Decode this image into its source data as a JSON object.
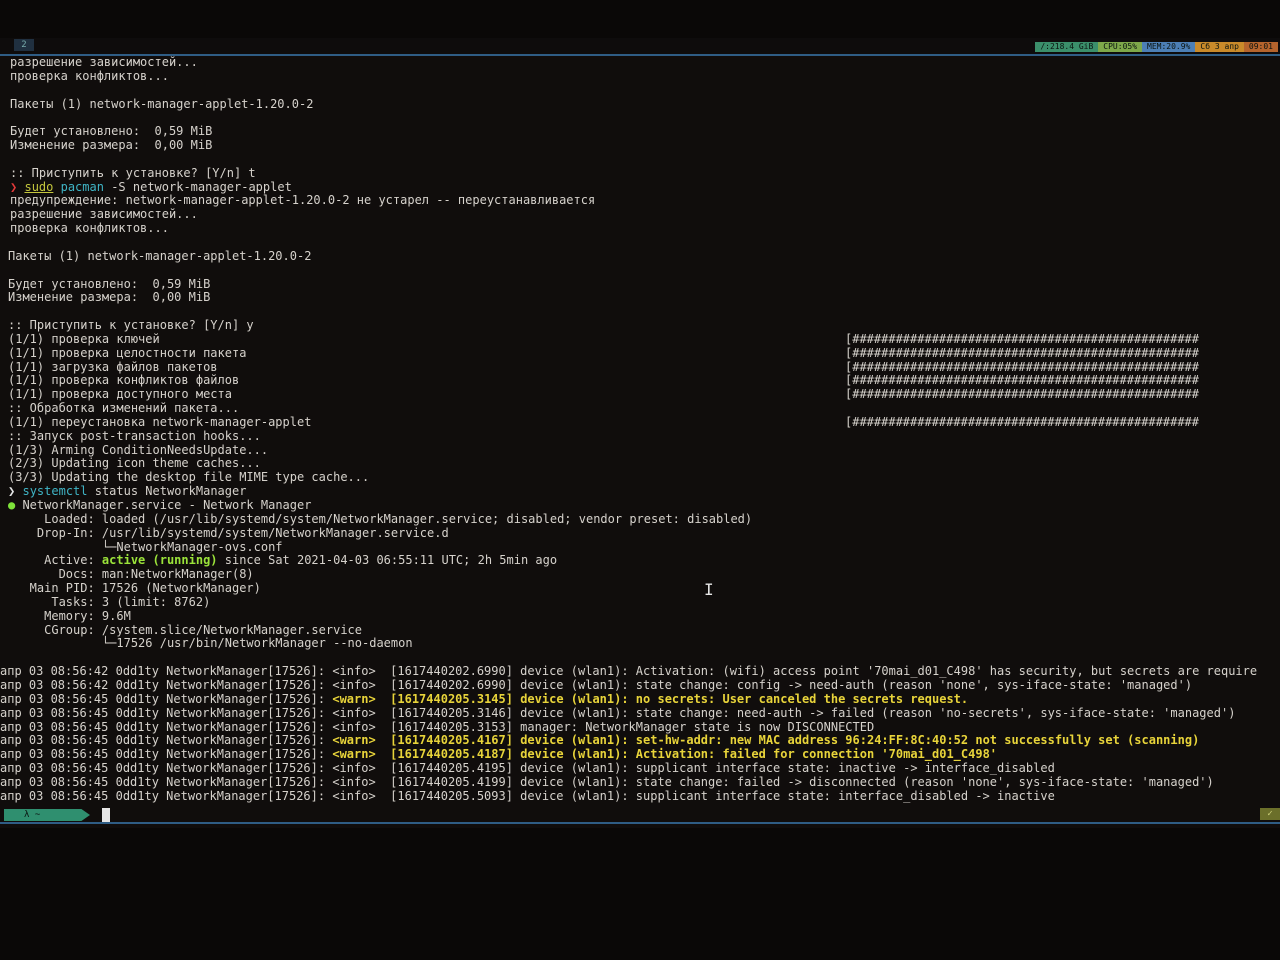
{
  "statusbar": {
    "workspace": "2",
    "disk": "/:218.4 GiB",
    "cpu": "CPU:05%",
    "mem": "MEM:20.9%",
    "date": "Сб 3 апр",
    "time": "09:01"
  },
  "terminal": {
    "lines": [
      {
        "text": "разрешение зависимостей...",
        "indent": "ind1"
      },
      {
        "text": "проверка конфликтов...",
        "indent": "ind1"
      },
      {
        "text": "",
        "indent": "ind1"
      },
      {
        "text": "Пакеты (1) network-manager-applet-1.20.0-2",
        "indent": "ind1"
      },
      {
        "text": "",
        "indent": "ind1"
      },
      {
        "text": "Будет установлено:  0,59 MiB",
        "indent": "ind1"
      },
      {
        "text": "Изменение размера:  0,00 MiB",
        "indent": "ind1"
      },
      {
        "text": "",
        "indent": "ind1"
      },
      {
        "text": ":: Приступить к установке? [Y/n] t",
        "indent": "ind1"
      },
      {
        "type": "cmd",
        "glyph": "❯",
        "glyph_class": "prompt-glyph",
        "sudo": "sudo",
        "cmd": "pacman",
        "rest": " -S network-manager-applet"
      },
      {
        "text": "предупреждение: network-manager-applet-1.20.0-2 не устарел -- переустанавливается",
        "indent": "ind1"
      },
      {
        "text": "разрешение зависимостей...",
        "indent": "ind1"
      },
      {
        "text": "проверка конфликтов...",
        "indent": "ind1"
      },
      {
        "text": "",
        "indent": "ind0"
      },
      {
        "text": "Пакеты (1) network-manager-applet-1.20.0-2",
        "indent": "ind0"
      },
      {
        "text": "",
        "indent": "ind0"
      },
      {
        "text": "Будет установлено:  0,59 MiB",
        "indent": "ind0"
      },
      {
        "text": "Изменение размера:  0,00 MiB",
        "indent": "ind0"
      },
      {
        "text": "",
        "indent": "ind0"
      },
      {
        "text": ":: Приступить к установке? [Y/n] y",
        "indent": "ind0"
      },
      {
        "text": "(1/1) проверка ключей",
        "indent": "ind0",
        "progress": "[################################################"
      },
      {
        "text": "(1/1) проверка целостности пакета",
        "indent": "ind0",
        "progress": "[################################################"
      },
      {
        "text": "(1/1) загрузка файлов пакетов",
        "indent": "ind0",
        "progress": "[################################################"
      },
      {
        "text": "(1/1) проверка конфликтов файлов",
        "indent": "ind0",
        "progress": "[################################################"
      },
      {
        "text": "(1/1) проверка доступного места",
        "indent": "ind0",
        "progress": "[################################################"
      },
      {
        "text": ":: Обработка изменений пакета...",
        "indent": "ind0"
      },
      {
        "text": "(1/1) переустановка network-manager-applet",
        "indent": "ind0",
        "progress": "[################################################"
      },
      {
        "text": ":: Запуск post-transaction hooks...",
        "indent": "ind0"
      },
      {
        "text": "(1/3) Arming ConditionNeedsUpdate...",
        "indent": "ind0"
      },
      {
        "text": "(2/3) Updating icon theme caches...",
        "indent": "ind0"
      },
      {
        "text": "(3/3) Updating the desktop file MIME type cache...",
        "indent": "ind0"
      },
      {
        "type": "cmd2",
        "glyph": "❯",
        "glyph_class": "prompt-glyph-w",
        "cmd": "systemctl",
        "rest": " status NetworkManager"
      },
      {
        "type": "svc",
        "dot": "●",
        "rest": " NetworkManager.service - Network Manager"
      },
      {
        "text": "     Loaded: loaded (/usr/lib/systemd/system/NetworkManager.service; disabled; vendor preset: disabled)",
        "indent": "ind0"
      },
      {
        "text": "    Drop-In: /usr/lib/systemd/system/NetworkManager.service.d",
        "indent": "ind0"
      },
      {
        "text": "             └─NetworkManager-ovs.conf",
        "indent": "ind0"
      },
      {
        "type": "active",
        "pre": "     Active: ",
        "state": "active (running)",
        "post": " since Sat 2021-04-03 06:55:11 UTC; 2h 5min ago"
      },
      {
        "text": "       Docs: man:NetworkManager(8)",
        "indent": "ind0"
      },
      {
        "text": "   Main PID: 17526 (NetworkManager)",
        "indent": "ind0"
      },
      {
        "text": "      Tasks: 3 (limit: 8762)",
        "indent": "ind0"
      },
      {
        "text": "     Memory: 9.6M",
        "indent": "ind0"
      },
      {
        "text": "     CGroup: /system.slice/NetworkManager.service",
        "indent": "ind0"
      },
      {
        "text": "             └─17526 /usr/bin/NetworkManager --no-daemon",
        "indent": "ind0"
      },
      {
        "text": "",
        "indent": "ind0"
      },
      {
        "type": "log",
        "prefix": "апр 03 08:56:42 0dd1ty NetworkManager[17526]: <info>  ",
        "msg": "[1617440202.6990] device (wlan1): Activation: (wifi) access point '70mai_d01_C498' has security, but secrets are require",
        "warn": false
      },
      {
        "type": "log",
        "prefix": "апр 03 08:56:42 0dd1ty NetworkManager[17526]: <info>  ",
        "msg": "[1617440202.6990] device (wlan1): state change: config -> need-auth (reason 'none', sys-iface-state: 'managed')",
        "warn": false
      },
      {
        "type": "log",
        "prefix": "апр 03 08:56:45 0dd1ty NetworkManager[17526]: ",
        "tag": "<warn>",
        "msg": "  [1617440205.3145] device (wlan1): no secrets: User canceled the secrets request.",
        "warn": true
      },
      {
        "type": "log",
        "prefix": "апр 03 08:56:45 0dd1ty NetworkManager[17526]: <info>  ",
        "msg": "[1617440205.3146] device (wlan1): state change: need-auth -> failed (reason 'no-secrets', sys-iface-state: 'managed')",
        "warn": false
      },
      {
        "type": "log",
        "prefix": "апр 03 08:56:45 0dd1ty NetworkManager[17526]: <info>  ",
        "msg": "[1617440205.3153] manager: NetworkManager state is now DISCONNECTED",
        "warn": false
      },
      {
        "type": "log",
        "prefix": "апр 03 08:56:45 0dd1ty NetworkManager[17526]: ",
        "tag": "<warn>",
        "msg": "  [1617440205.4167] device (wlan1): set-hw-addr: new MAC address 96:24:FF:8C:40:52 not successfully set (scanning)",
        "warn": true
      },
      {
        "type": "log",
        "prefix": "апр 03 08:56:45 0dd1ty NetworkManager[17526]: ",
        "tag": "<warn>",
        "msg": "  [1617440205.4187] device (wlan1): Activation: failed for connection '70mai_d01_C498'",
        "warn": true
      },
      {
        "type": "log",
        "prefix": "апр 03 08:56:45 0dd1ty NetworkManager[17526]: <info>  ",
        "msg": "[1617440205.4195] device (wlan1): supplicant interface state: inactive -> interface_disabled",
        "warn": false
      },
      {
        "type": "log",
        "prefix": "апр 03 08:56:45 0dd1ty NetworkManager[17526]: <info>  ",
        "msg": "[1617440205.4199] device (wlan1): state change: failed -> disconnected (reason 'none', sys-iface-state: 'managed')",
        "warn": false
      },
      {
        "type": "log",
        "prefix": "апр 03 08:56:45 0dd1ty NetworkManager[17526]: <info>  ",
        "msg": "[1617440205.5093] device (wlan1): supplicant interface state: interface_disabled -> inactive",
        "warn": false
      }
    ]
  },
  "prompt": {
    "segment": "λ ~"
  }
}
